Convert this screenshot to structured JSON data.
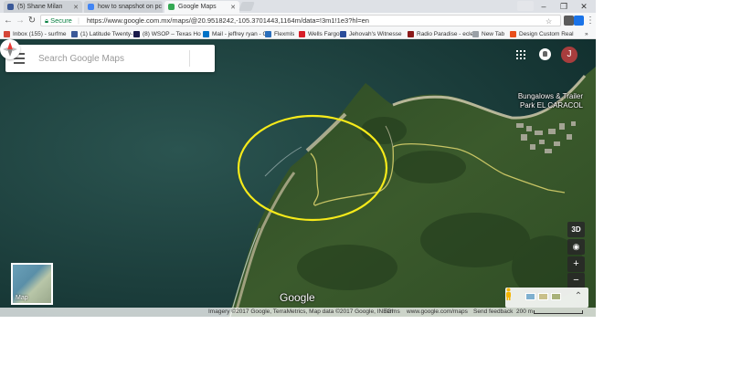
{
  "browser": {
    "tabs": [
      {
        "title": "(5) Shane Milan",
        "favicon_color": "#3b5998",
        "active": false
      },
      {
        "title": "how to snapshot on pc",
        "favicon_color": "#4285f4",
        "active": false
      },
      {
        "title": "Google Maps",
        "favicon_color": "#34a853",
        "active": true
      }
    ],
    "window_controls": {
      "minimize": "–",
      "maximize": "❐",
      "close": "✕"
    },
    "toolbar": {
      "secure_label": "Secure",
      "url": "https://www.google.com.mx/maps/@20.9518242,-105.3701443,1164m/data=!3m1!1e3?hl=en"
    },
    "bookmarks": [
      {
        "label": "Inbox (155) - surfme",
        "color": "#d44638"
      },
      {
        "label": "(1) Latitude Twenty-",
        "color": "#3b5998"
      },
      {
        "label": "(8) WSOP – Texas Ho",
        "color": "#1a1a4a"
      },
      {
        "label": "Mail - jeffrey ryan - C",
        "color": "#0072c6"
      },
      {
        "label": "Flexmls",
        "color": "#2a6ebb"
      },
      {
        "label": "Wells Fargo",
        "color": "#d71e28"
      },
      {
        "label": "Jehovah's Witnesse",
        "color": "#2a4c9a"
      },
      {
        "label": "Radio Paradise - ecle",
        "color": "#8b1a1a"
      },
      {
        "label": "New Tab",
        "color": "#9aa0a6"
      },
      {
        "label": "Design Custom Real",
        "color": "#e94e1b"
      }
    ],
    "bookmarks_more": "»"
  },
  "maps": {
    "search_placeholder": "Search Google Maps",
    "avatar_initial": "J",
    "place_label": [
      "Bungalows & Trailer",
      "Park EL CARACOL"
    ],
    "controls": {
      "three_d": "3D",
      "zoom_in": "+",
      "zoom_out": "−",
      "expand": "⌃"
    },
    "minimap_label": "Map",
    "logo": "Google",
    "attribution": {
      "imagery": "Imagery ©2017 Google, TerraMetrics, Map data ©2017 Google, INEGI",
      "terms": "Terms",
      "url": "www.google.com/maps",
      "feedback": "Send feedback",
      "scale": "200 m"
    }
  }
}
